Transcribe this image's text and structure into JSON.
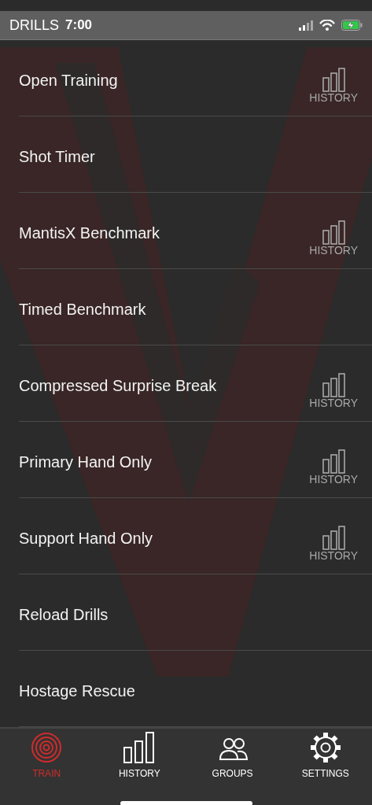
{
  "status_bar": {
    "time": "7:00"
  },
  "header": {
    "title": "DRILLS"
  },
  "drills": [
    {
      "name": "Open Training",
      "history_label": "HISTORY"
    },
    {
      "name": "Shot Timer"
    },
    {
      "name": "MantisX Benchmark",
      "history_label": "HISTORY"
    },
    {
      "name": "Timed Benchmark"
    },
    {
      "name": "Compressed Surprise Break",
      "history_label": "HISTORY"
    },
    {
      "name": "Primary Hand Only",
      "history_label": "HISTORY"
    },
    {
      "name": "Support Hand Only",
      "history_label": "HISTORY"
    },
    {
      "name": "Reload Drills"
    },
    {
      "name": "Hostage Rescue"
    }
  ],
  "tabs": [
    {
      "label": "TRAIN",
      "kind": "target",
      "selected": true
    },
    {
      "label": "HISTORY",
      "kind": "bars",
      "selected": false
    },
    {
      "label": "GROUPS",
      "kind": "people",
      "selected": false
    },
    {
      "label": "SETTINGS",
      "kind": "gear",
      "selected": false
    }
  ]
}
